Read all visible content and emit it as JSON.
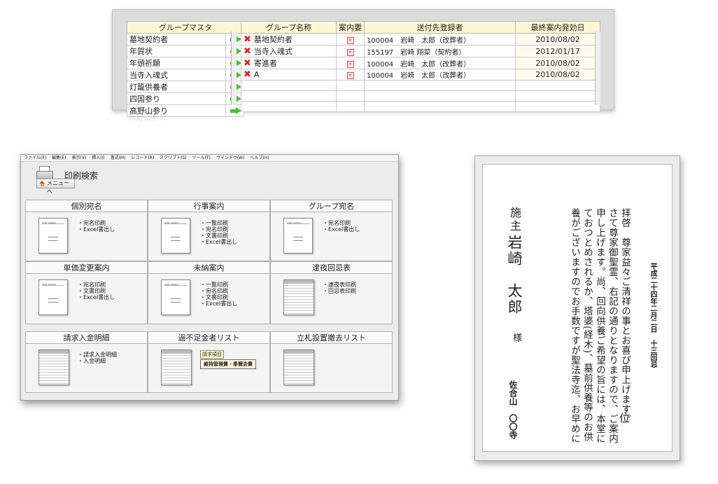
{
  "master_table": {
    "header": "グループマスタ",
    "rows": [
      "墓地契約者",
      "年賀状",
      "年頭祈願",
      "当寺入魂式",
      "灯籠供養者",
      "四国参り",
      "高野山参り"
    ]
  },
  "group_table": {
    "headers": [
      "グループ名称",
      "案内要",
      "送付先登録者",
      "最終案内発効日"
    ],
    "rows": [
      {
        "name": "墓地契約者",
        "sendto": "100004　岩崎　太郎（改葬者）",
        "date": "2010/08/02"
      },
      {
        "name": "当寺入魂式",
        "sendto": "155197　岩崎 翔菜（契約者）",
        "date": "2012/01/17"
      },
      {
        "name": "寄進者",
        "sendto": "100004　岩崎　太郎（改葬者）",
        "date": "2010/08/02"
      },
      {
        "name": "A",
        "sendto": "100004　岩崎　太郎（改葬者）",
        "date": "2010/08/02"
      }
    ]
  },
  "app": {
    "menu": [
      "ファイル(F)",
      "編集(E)",
      "表示(V)",
      "挿入(I)",
      "書式(M)",
      "レコード(R)",
      "スクリプト(S)",
      "ツール(T)",
      "ウインドウ(W)",
      "ヘルプ(H)"
    ],
    "title": "印刷検索",
    "menu_button": "メニューへ",
    "cells": [
      {
        "title": "個別宛名",
        "items": [
          "・宛名印刷",
          "・Excel書出し"
        ]
      },
      {
        "title": "行事案内",
        "items": [
          "・一覧印刷",
          "・宛名印刷",
          "・文書印刷",
          "・Excel書出し"
        ]
      },
      {
        "title": "グループ宛名",
        "items": [
          "・宛名印刷",
          "・Excel書出し"
        ]
      },
      {
        "title": "単価変更案内",
        "items": [
          "・宛名印刷",
          "・文書印刷",
          "・Excel書出し"
        ]
      },
      {
        "title": "未納案内",
        "items": [
          "・一覧印刷",
          "・宛名印刷",
          "・文書印刷",
          "・Excel書出し"
        ]
      },
      {
        "title": "逮夜回忌表",
        "items": [
          "・逮夜表印刷",
          "・回忌表印刷"
        ]
      },
      {
        "title": "請求入金明細",
        "items": [
          "・請求入金明細",
          "・入金明細"
        ]
      },
      {
        "title": "過不足金者リスト",
        "items": []
      },
      {
        "title": "立札設置撤去リスト",
        "items": []
      }
    ],
    "note_tag": "請求項目",
    "note_value": "維持管理費・奉賛会費"
  },
  "letter": {
    "lines": [
      "拝啓　尊家益々ご清祥の事とお喜び申上げます。",
      "さて尊家御聖霊、右記の通りとなりますので、ご案内",
      "申し上げます。尚、回向供養ご希望の旨には、本堂に",
      "ておつとめされるか、塔婆(経木)、墓前供養等のお供",
      "養がございますのでお手数ですが聖法寺迄、お早めに"
    ],
    "date": "平成二十四年二月二日　十三回忌",
    "kurai": "位",
    "seshu": "施主",
    "name": "岩崎　太郎",
    "sama": "様",
    "temple": "佐合山　〇〇寺"
  }
}
